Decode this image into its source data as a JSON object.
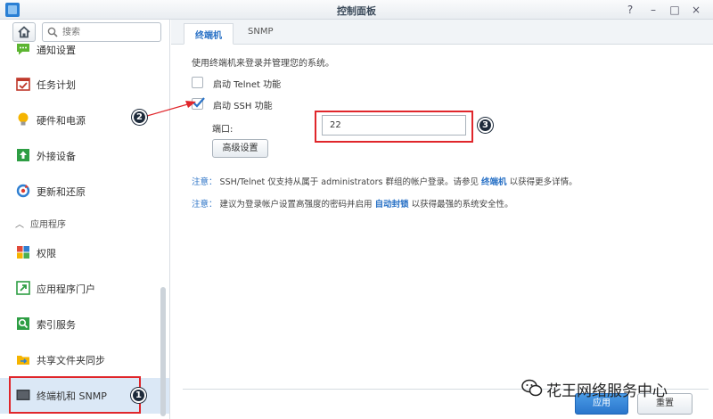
{
  "window": {
    "title": "控制面板"
  },
  "window_controls": [
    "?",
    "–",
    "□",
    "×"
  ],
  "sidebar": {
    "search_placeholder": "搜索",
    "items": [
      {
        "label": "通知设置",
        "icon": "chat-bubble-icon"
      },
      {
        "label": "任务计划",
        "icon": "calendar-check-icon"
      },
      {
        "label": "硬件和电源",
        "icon": "lightbulb-icon"
      },
      {
        "label": "外接设备",
        "icon": "upload-device-icon"
      },
      {
        "label": "更新和还原",
        "icon": "refresh-icon"
      }
    ],
    "section": {
      "label": "应用程序"
    },
    "app_items": [
      {
        "label": "权限",
        "icon": "grid-icon"
      },
      {
        "label": "应用程序门户",
        "icon": "portal-arrow-icon"
      },
      {
        "label": "索引服务",
        "icon": "magnifier-icon"
      },
      {
        "label": "共享文件夹同步",
        "icon": "folder-sync-icon"
      },
      {
        "label": "终端机和 SNMP",
        "icon": "terminal-icon"
      }
    ]
  },
  "tabs": [
    "终端机",
    "SNMP"
  ],
  "terminal": {
    "description": "使用终端机来登录并管理您的系统。",
    "telnet_label": "启动 Telnet 功能",
    "telnet_checked": false,
    "ssh_label": "启动 SSH 功能",
    "ssh_checked": true,
    "port_label": "端口:",
    "port_value": "22",
    "advanced_button": "高级设置"
  },
  "notes": [
    {
      "label": "注意：",
      "text_before": "SSH/Telnet 仅支持从属于 administrators 群组的帐户登录。请参见",
      "link": "终端机",
      "text_after": "以获得更多详情。"
    },
    {
      "label": "注意：",
      "text_before": "建议为登录帐户设置高强度的密码并启用",
      "link": "自动封锁",
      "text_after": "以获得最强的系统安全性。"
    }
  ],
  "footer": {
    "apply": "应用",
    "reset": "重置"
  },
  "annotations": {
    "marker1": "1",
    "marker2": "2",
    "marker3": "3",
    "accent_color": "#e0262b"
  },
  "watermark": {
    "text": "花王网络服务中心"
  }
}
